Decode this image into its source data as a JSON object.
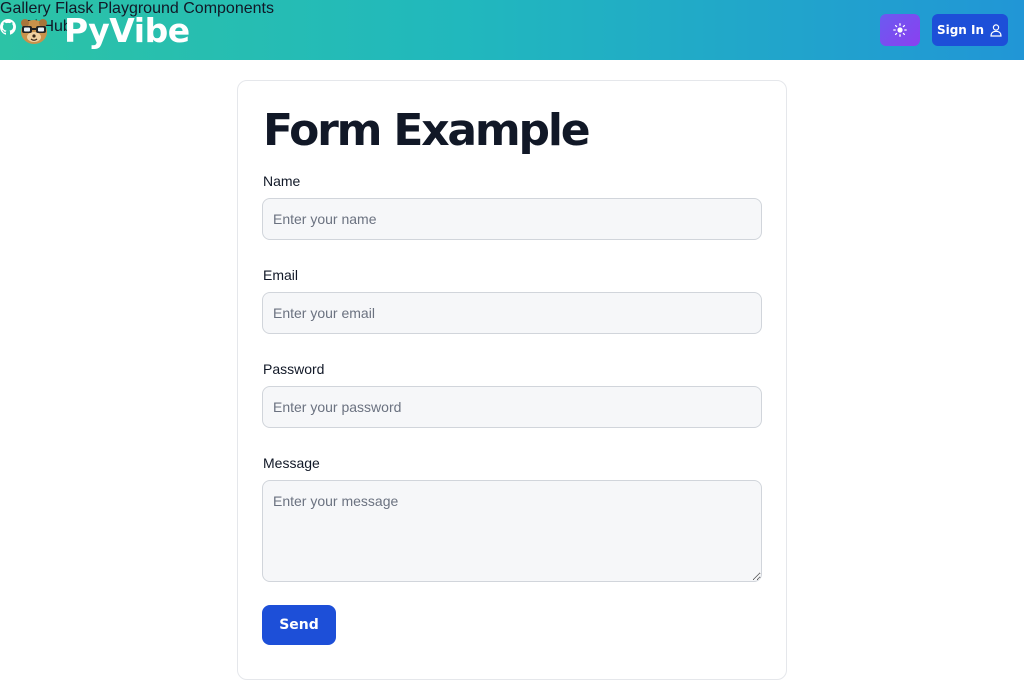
{
  "header": {
    "brand": "PyVibe",
    "logo_icon": "nerd-face-icon",
    "nav": [
      {
        "label": "Gallery"
      },
      {
        "label": "Flask"
      },
      {
        "label": "Playground"
      },
      {
        "label": "Components"
      },
      {
        "label": "GitHub",
        "icon": "github-icon"
      }
    ],
    "theme_icon": "sun-icon",
    "signin_label": "Sign In",
    "signin_icon": "user-icon",
    "colors": {
      "gradient_start": "#2cc3a6",
      "gradient_end": "#2196d6",
      "primary": "#1d4fd8",
      "theme_btn": "#7a4cf0"
    }
  },
  "form": {
    "title": "Form Example",
    "fields": [
      {
        "label": "Name",
        "placeholder": "Enter your name",
        "value": ""
      },
      {
        "label": "Email",
        "placeholder": "Enter your email",
        "value": ""
      },
      {
        "label": "Password",
        "placeholder": "Enter your password",
        "value": ""
      },
      {
        "label": "Message",
        "placeholder": "Enter your message",
        "value": ""
      }
    ],
    "submit_label": "Send"
  }
}
